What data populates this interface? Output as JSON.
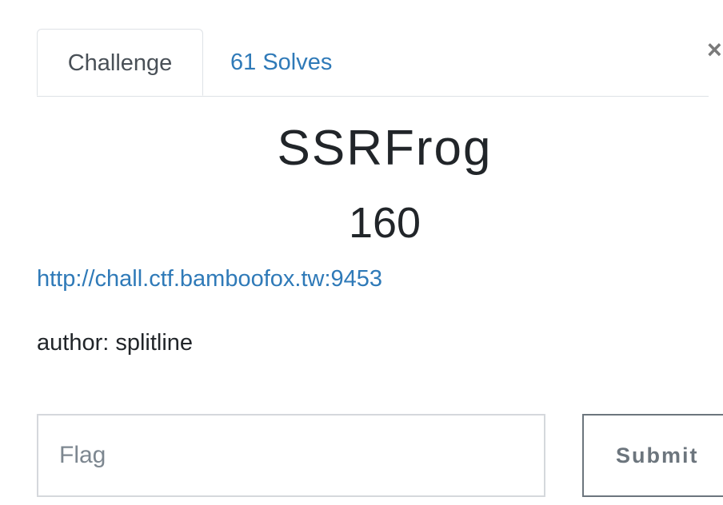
{
  "tabs": {
    "challenge_label": "Challenge",
    "solves_label": "61 Solves"
  },
  "close": {
    "glyph": "×",
    "icon": "close-icon"
  },
  "challenge": {
    "name": "SSRFrog",
    "value": "160",
    "link_text": "http://chall.ctf.bamboofox.tw:9453",
    "description": "author: splitline"
  },
  "form": {
    "flag_placeholder": "Flag",
    "flag_value": "",
    "submit_label": "Submit"
  },
  "colors": {
    "link": "#2f7ab8",
    "text": "#212529",
    "border": "#dee2e6",
    "button": "#6c757d"
  }
}
